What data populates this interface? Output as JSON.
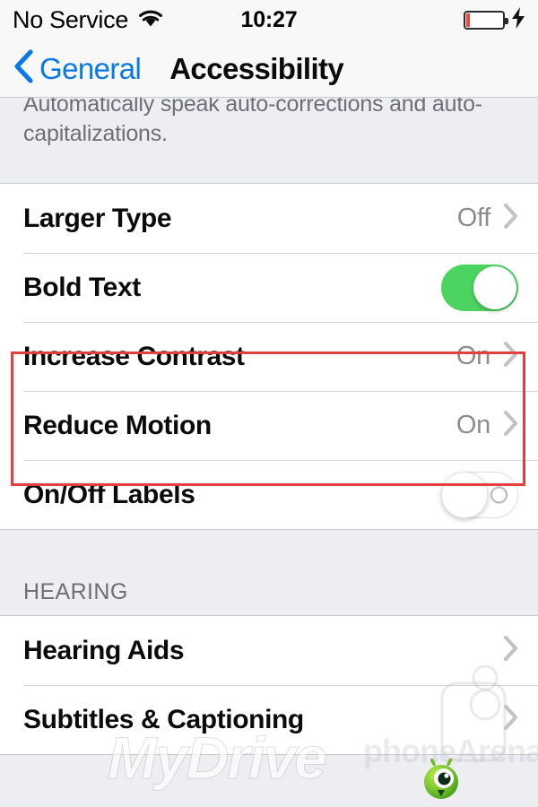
{
  "status_bar": {
    "carrier": "No Service",
    "wifi_icon": "wifi-icon",
    "time": "10:27",
    "battery_icon": "battery-low-icon",
    "charging_icon": "lightning-bolt-icon"
  },
  "nav_bar": {
    "back_icon": "chevron-left-icon",
    "back_label": "General",
    "title": "Accessibility"
  },
  "footer_note": {
    "text": "Automatically speak auto-corrections and auto-capitalizations."
  },
  "vision_group": {
    "rows": [
      {
        "label": "Larger Type",
        "value": "Off",
        "accessory": "chevron-right-icon",
        "type": "disclosure"
      },
      {
        "label": "Bold Text",
        "value": "On",
        "accessory": "toggle-on",
        "type": "switch"
      },
      {
        "label": "Increase Contrast",
        "value": "On",
        "accessory": "chevron-right-icon",
        "type": "disclosure"
      },
      {
        "label": "Reduce Motion",
        "value": "On",
        "accessory": "chevron-right-icon",
        "type": "disclosure"
      },
      {
        "label": "On/Off Labels",
        "value": "Off",
        "accessory": "toggle-off",
        "type": "switch"
      }
    ]
  },
  "hearing_section": {
    "header": "HEARING",
    "rows": [
      {
        "label": "Hearing Aids",
        "accessory": "chevron-right-icon"
      },
      {
        "label": "Subtitles & Captioning",
        "accessory": "chevron-right-icon"
      }
    ]
  },
  "annotation": {
    "name": "red-highlight-box",
    "color": "#e1403f",
    "highlights": [
      "Increase Contrast",
      "Reduce Motion"
    ]
  },
  "watermarks": {
    "mydrivers": "MyDrive",
    "phonearena": "phoneArena",
    "mascot": "phonearena-mascot-icon"
  },
  "colors": {
    "tint_blue": "#0a79e8",
    "toggle_green": "#4cd461",
    "group_background": "#eceef2",
    "row_background": "#ffffff",
    "value_gray": "#8c8c90",
    "annotation_red": "#e1403f",
    "battery_red": "#f4423c"
  }
}
